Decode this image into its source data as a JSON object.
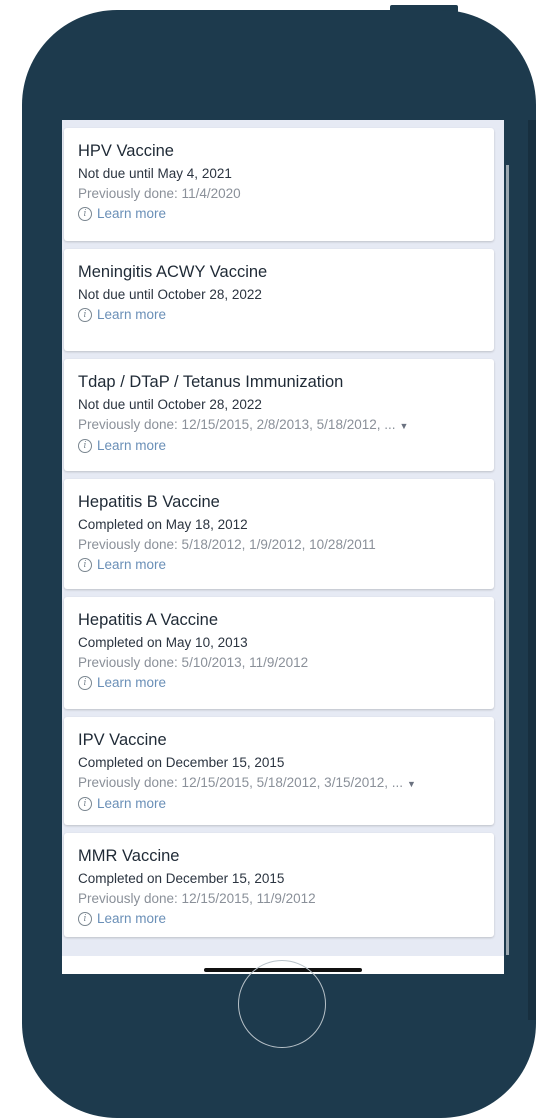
{
  "colors": {
    "phone_body": "#1d3a4d",
    "screen_bg": "#e6eaf4",
    "card_bg": "#ffffff",
    "title_text": "#1f2a36",
    "muted_text": "#8a9099",
    "link_text": "#6a8fb7"
  },
  "immunizations": [
    {
      "title": "HPV Vaccine",
      "status": "Not due until May 4, 2021",
      "previously_done": "Previously done: 11/4/2020",
      "learn_more": "Learn more"
    },
    {
      "title": "Meningitis ACWY Vaccine",
      "status": "Not due until October 28, 2022",
      "learn_more": "Learn more"
    },
    {
      "title": "Tdap / DTaP / Tetanus Immunization",
      "status": "Not due until October 28, 2022",
      "previously_done": "Previously done: 12/15/2015, 2/8/2013, 5/18/2012, ...",
      "learn_more": "Learn more",
      "expand_icon": "caret-down-icon"
    },
    {
      "title": "Hepatitis B Vaccine",
      "status": "Completed on May 18, 2012",
      "previously_done": "Previously done: 5/18/2012, 1/9/2012, 10/28/2011",
      "learn_more": "Learn more"
    },
    {
      "title": "Hepatitis A Vaccine",
      "status": "Completed on May 10, 2013",
      "previously_done": "Previously done: 5/10/2013, 11/9/2012",
      "learn_more": "Learn more"
    },
    {
      "title": "IPV Vaccine",
      "status": "Completed on December 15, 2015",
      "previously_done": "Previously done: 12/15/2015, 5/18/2012, 3/15/2012, ...",
      "learn_more": "Learn more",
      "expand_icon": "caret-down-icon"
    },
    {
      "title": "MMR Vaccine",
      "status": "Completed on December 15, 2015",
      "previously_done": "Previously done: 12/15/2015, 11/9/2012",
      "learn_more": "Learn more"
    }
  ],
  "info_icon_glyph": "i",
  "caret_glyph": "▼"
}
